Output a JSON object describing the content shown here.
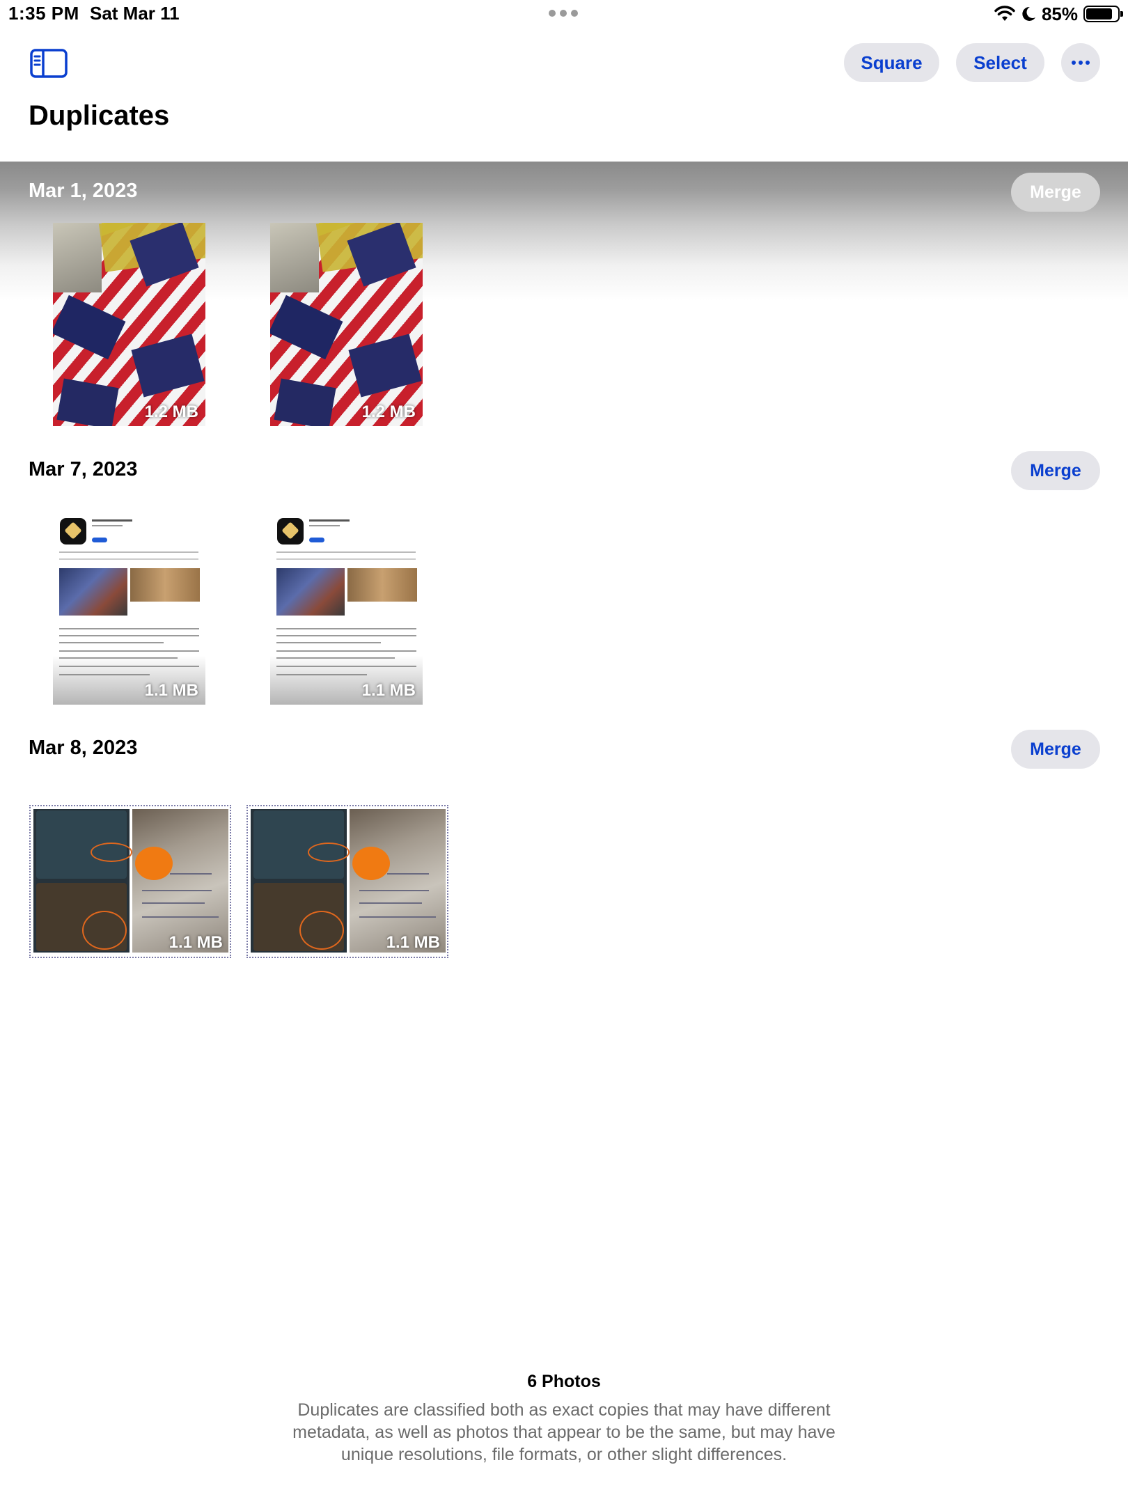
{
  "status_bar": {
    "time": "1:35 PM",
    "date": "Sat Mar 11",
    "battery_text": "85%",
    "battery_level": 0.85,
    "icons": [
      "wifi-icon",
      "moon-icon",
      "battery-icon"
    ]
  },
  "toolbar": {
    "sidebar_icon": "sidebar-icon",
    "square_label": "Square",
    "select_label": "Select",
    "more_icon": "ellipsis-icon"
  },
  "page": {
    "title": "Duplicates"
  },
  "groups": [
    {
      "date": "Mar 1, 2023",
      "merge_label": "Merge",
      "photos": [
        {
          "size": "1.2 MB"
        },
        {
          "size": "1.2 MB"
        }
      ]
    },
    {
      "date": "Mar 7, 2023",
      "merge_label": "Merge",
      "photos": [
        {
          "size": "1.1 MB"
        },
        {
          "size": "1.1 MB"
        }
      ]
    },
    {
      "date": "Mar 8, 2023",
      "merge_label": "Merge",
      "photos": [
        {
          "size": "1.1 MB"
        },
        {
          "size": "1.1 MB"
        }
      ]
    }
  ],
  "footer": {
    "count": "6 Photos",
    "description": "Duplicates are classified both as exact copies that may have different metadata, as well as photos that appear to be the same, but may have unique resolutions, file formats, or other slight differences."
  },
  "colors": {
    "accent": "#0A3FCF",
    "button_bg": "#E5E5EA",
    "secondary_text": "#6B6B6B"
  }
}
